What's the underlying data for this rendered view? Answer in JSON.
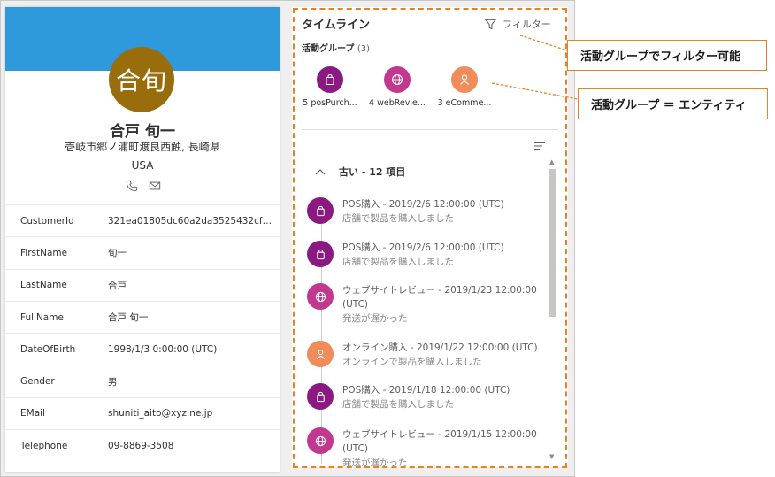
{
  "profile": {
    "avatar_initials": "合旬",
    "name": "合戸 旬一",
    "address": "壱岐市郷ノ浦町渡良西触, 長崎県",
    "country": "USA",
    "fields": [
      {
        "label": "CustomerId",
        "value": "321ea01805dc60a2da3525432cf75..."
      },
      {
        "label": "FirstName",
        "value": "旬一"
      },
      {
        "label": "LastName",
        "value": "合戸"
      },
      {
        "label": "FullName",
        "value": "合戸 旬一"
      },
      {
        "label": "DateOfBirth",
        "value": "1998/1/3 0:00:00 (UTC)"
      },
      {
        "label": "Gender",
        "value": "男"
      },
      {
        "label": "EMail",
        "value": "shuniti_aito@xyz.ne.jp"
      },
      {
        "label": "Telephone",
        "value": "09-8869-3508"
      }
    ]
  },
  "timeline": {
    "title": "タイムライン",
    "filter_label": "フィルター",
    "groups_label": "活動グループ",
    "groups_count": "(3)",
    "groups": [
      {
        "label": "5 posPurch...",
        "icon": "shopping-bag-icon",
        "color": "#8a1a82"
      },
      {
        "label": "4 webRevie...",
        "icon": "globe-icon",
        "color": "#c2388f"
      },
      {
        "label": "3 eComme...",
        "icon": "person-icon",
        "color": "#f08b5a"
      }
    ],
    "older_label": "古い - 12 項目",
    "entries": [
      {
        "title": "POS購入 - 2019/2/6 12:00:00 (UTC)",
        "desc": "店舗で製品を購入しました",
        "icon": "shopping-bag-icon",
        "color": "#8a1a82"
      },
      {
        "title": "POS購入 - 2019/2/6 12:00:00 (UTC)",
        "desc": "店舗で製品を購入しました",
        "icon": "shopping-bag-icon",
        "color": "#8a1a82"
      },
      {
        "title": "ウェブサイトレビュー - 2019/1/23 12:00:00 (UTC)",
        "desc": "発送が遅かった",
        "icon": "globe-icon",
        "color": "#c2388f"
      },
      {
        "title": "オンライン購入 - 2019/1/22 12:00:00 (UTC)",
        "desc": "オンラインで製品を購入しました",
        "icon": "person-icon",
        "color": "#f08b5a"
      },
      {
        "title": "POS購入 - 2019/1/18 12:00:00 (UTC)",
        "desc": "店舗で製品を購入しました",
        "icon": "shopping-bag-icon",
        "color": "#8a1a82"
      },
      {
        "title": "ウェブサイトレビュー - 2019/1/15 12:00:00 (UTC)",
        "desc": "発送が遅かった",
        "icon": "globe-icon",
        "color": "#c2388f"
      }
    ]
  },
  "callouts": {
    "filter_note": "活動グループでフィルター可能",
    "entity_note": "活動グループ ＝ エンティティ"
  },
  "colors": {
    "banner": "#2e9adb",
    "avatar": "#9a6d0c",
    "highlight": "#e8821e"
  }
}
